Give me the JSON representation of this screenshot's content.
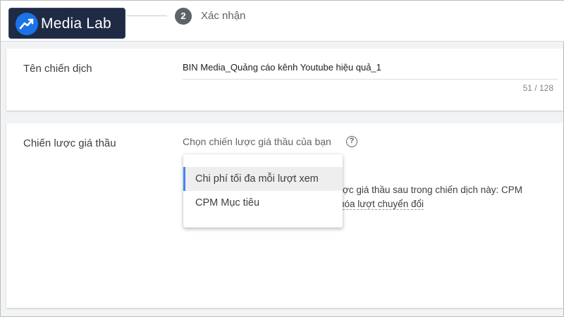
{
  "logo": {
    "text": "Media Lab",
    "icon": "trending-up-icon",
    "brand_color": "#1a73e8"
  },
  "stepper": {
    "step_number": "2",
    "step_label": "Xác nhận"
  },
  "campaign_name": {
    "label": "Tên chiến dịch",
    "value": "BIN Media_Quảng cáo kênh Youtube hiệu quả_1",
    "char_count": "51 / 128"
  },
  "bidding": {
    "label": "Chiến lược giá thầu",
    "prompt": "Chọn chiến lược giá thầu của bạn",
    "help_icon": "help-circle-icon",
    "note_line1": "ược giá thầu sau trong chiến dịch này: CPM",
    "note_line2": "hóa lượt chuyển đổi"
  },
  "menu": {
    "items": [
      {
        "label": "Chi phí tối đa mỗi lượt xem",
        "selected": true
      },
      {
        "label": "CPM Mục tiêu",
        "selected": false
      }
    ],
    "accent_color": "#4285f4"
  }
}
